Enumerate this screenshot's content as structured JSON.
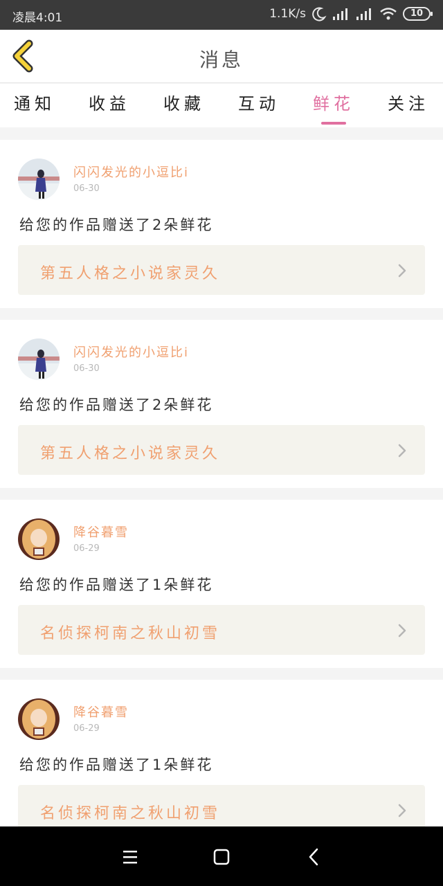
{
  "status": {
    "time": "凌晨4:01",
    "speed": "1.1K/s",
    "battery": "10"
  },
  "header": {
    "title": "消息"
  },
  "tabs": [
    {
      "label": "通知",
      "active": false
    },
    {
      "label": "收益",
      "active": false
    },
    {
      "label": "收藏",
      "active": false
    },
    {
      "label": "互动",
      "active": false
    },
    {
      "label": "鲜花",
      "active": true
    },
    {
      "label": "关注",
      "active": false
    }
  ],
  "messages": [
    {
      "user": "闪闪发光的小逗比i",
      "date": "06-30",
      "text": "给您的作品赠送了2朵鲜花",
      "work": "第五人格之小说家灵久"
    },
    {
      "user": "闪闪发光的小逗比i",
      "date": "06-30",
      "text": "给您的作品赠送了2朵鲜花",
      "work": "第五人格之小说家灵久"
    },
    {
      "user": "降谷暮雪",
      "date": "06-29",
      "text": "给您的作品赠送了1朵鲜花",
      "work": "名侦探柯南之秋山初雪"
    },
    {
      "user": "降谷暮雪",
      "date": "06-29",
      "text": "给您的作品赠送了1朵鲜花",
      "work": "名侦探柯南之秋山初雪"
    }
  ],
  "colors": {
    "accent": "#e070a0",
    "name": "#f0a070",
    "back": "#f5d23a"
  },
  "icons": {
    "back": "chevron-left-icon",
    "menu": "menu-icon",
    "home": "home-icon",
    "nav_back": "back-icon"
  }
}
